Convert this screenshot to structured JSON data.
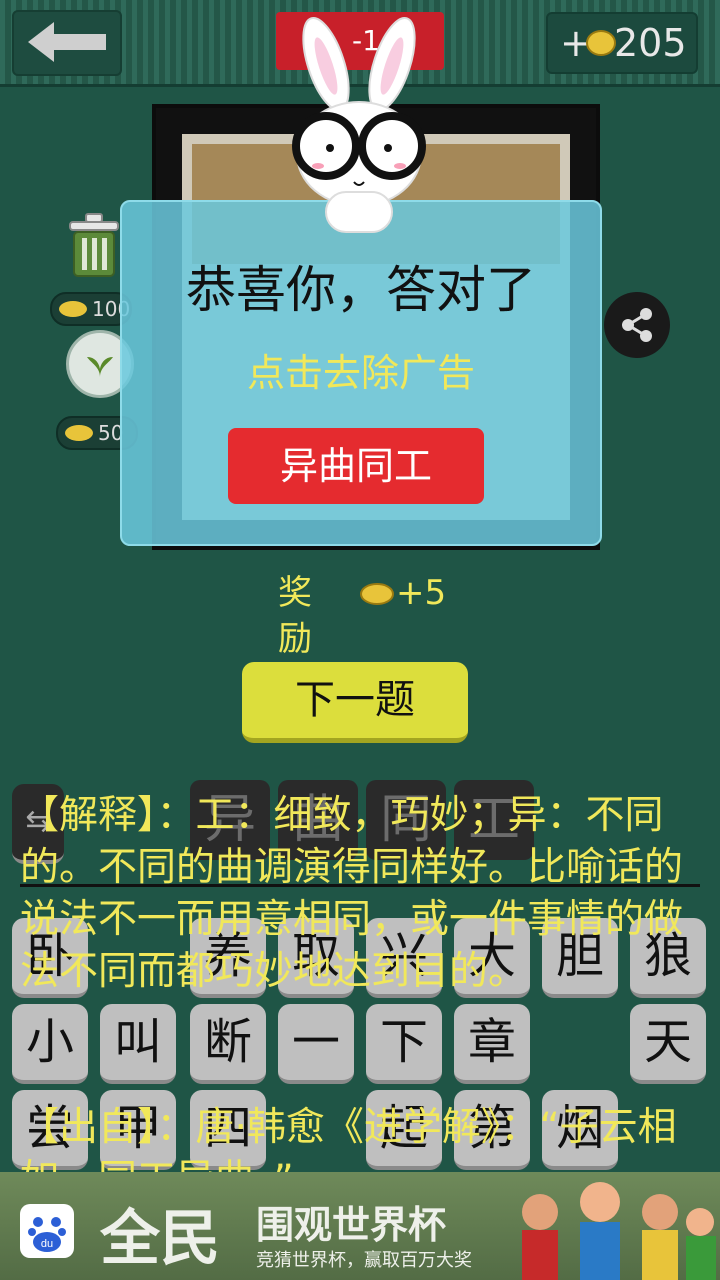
{
  "topbar": {
    "level": "-1",
    "coins_prefix": "+",
    "coins": "205"
  },
  "tools": {
    "remove_cost": "100",
    "hint_cost": "50"
  },
  "dialog": {
    "title": "恭喜你，答对了",
    "remove_ads": "点击去除广告",
    "answer": "异曲同工"
  },
  "reward": {
    "label": "奖励",
    "amount": "+5"
  },
  "next_label": "下一题",
  "answer_slots": [
    "异",
    "曲",
    "同",
    "工"
  ],
  "keyboard": {
    "row1": [
      "卧",
      "养",
      "取",
      "兴",
      "大",
      "胆",
      "狼"
    ],
    "row2": [
      "小",
      "叫",
      "断",
      "一",
      "下",
      "章",
      "天"
    ],
    "row3": [
      "尝",
      "甲",
      "四",
      "起",
      "第",
      "烟"
    ]
  },
  "explanation": "【解释】：工：细致，巧妙；异：不同的。不同的曲调演得同样好。比喻话的说法不一而用意相同，或一件事情的做法不同而都巧妙地达到目的。",
  "source": "【出自】：唐·韩愈《进学解》：“子云相如，同工异曲。”",
  "ad": {
    "big": "全民",
    "headline": "围观世界杯",
    "sub": "竞猜世界杯，赢取百万大奖",
    "logo": "du"
  },
  "colors": {
    "accent_yellow": "#f1e85a",
    "answer_red": "#e52b2f",
    "next_yellow": "#dcde3c",
    "dialog": "#6ac8dd"
  }
}
